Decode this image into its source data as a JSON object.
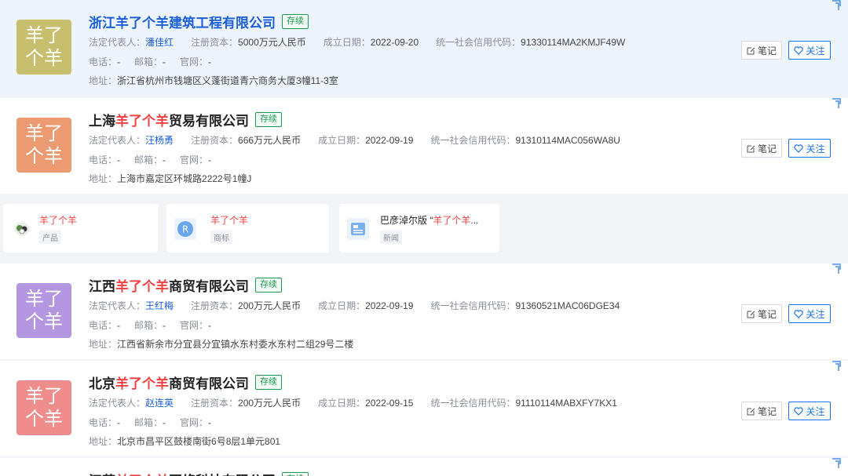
{
  "labels": {
    "legal_rep": "法定代表人：",
    "capital": "注册资本：",
    "founded": "成立日期：",
    "credit": "统一社会信用代码：",
    "phone": "电话：",
    "email": "邮箱：",
    "site": "官网：",
    "addr": "地址："
  },
  "buttons": {
    "note": "笔记",
    "follow": "关注"
  },
  "companies": [
    {
      "logo1": "羊了",
      "logo2": "个羊",
      "logo_color": "#c8bf6e",
      "t_pre": "",
      "t_kw": "浙江羊了个羊建筑工程有限公司",
      "t_post": "",
      "status": "存续",
      "rep": "潘佳红",
      "capital": "5000万元人民币",
      "date": "2022-09-20",
      "credit": "91330114MA2KMJF49W",
      "phone": "-",
      "email": "-",
      "site": "-",
      "address": "浙江省杭州市钱塘区义蓬街道青六商务大厦3幢11-3室"
    },
    {
      "logo1": "羊了",
      "logo2": "个羊",
      "logo_color": "#eb9a72",
      "t_pre": "上海",
      "t_kw": "羊了个羊",
      "t_post": "贸易有限公司",
      "status": "存续",
      "rep": "汪杨勇",
      "capital": "666万元人民币",
      "date": "2022-09-19",
      "credit": "91310114MAC056WA8U",
      "phone": "-",
      "email": "-",
      "site": "-",
      "address": "上海市嘉定区环城路2222号1幢J"
    },
    {
      "logo1": "羊了",
      "logo2": "个羊",
      "logo_color": "#b497e0",
      "t_pre": "江西",
      "t_kw": "羊了个羊",
      "t_post": "商贸有限公司",
      "status": "存续",
      "rep": "王红梅",
      "capital": "200万元人民币",
      "date": "2022-09-19",
      "credit": "91360521MAC06DGE34",
      "phone": "-",
      "email": "-",
      "site": "-",
      "address": "江西省新余市分宜县分宜镇水东村委水东村二组29号二楼"
    },
    {
      "logo1": "羊了",
      "logo2": "个羊",
      "logo_color": "#ef8c8c",
      "t_pre": "北京",
      "t_kw": "羊了个羊",
      "t_post": "商贸有限公司",
      "status": "存续",
      "rep": "赵连英",
      "capital": "200万元人民币",
      "date": "2022-09-15",
      "credit": "91110114MABXFY7KX1",
      "phone": "-",
      "email": "-",
      "site": "-",
      "address": "北京市昌平区鼓楼南街6号8层1单元801"
    },
    {
      "t_pre": "江苏",
      "t_kw": "羊了个羊",
      "t_post": "网络科技有限公司",
      "status": "存续"
    }
  ],
  "related": [
    {
      "title_kw": "羊了个羊",
      "title_rest": "",
      "sub": "产品",
      "icon": "sheep-product-icon"
    },
    {
      "title_kw": "羊了个羊",
      "title_rest": "",
      "sub": "商标",
      "icon": "trademark-r-icon"
    },
    {
      "title_pre": "巴彦淖尔版 “",
      "title_kw": "羊了个羊",
      "title_post": "...",
      "sub": "新闻",
      "icon": "news-icon"
    }
  ],
  "colors": {
    "accent": "#1a73e8",
    "keyword": "#f04141",
    "status": "#1c9b4f"
  }
}
